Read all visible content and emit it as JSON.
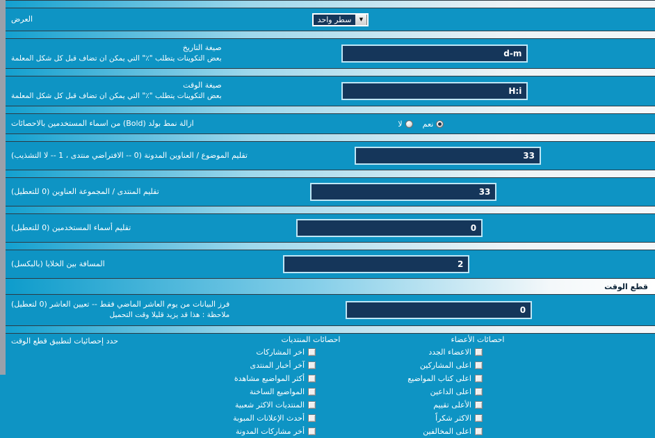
{
  "colors": {
    "page_bg": "#0e94c4",
    "input_bg": "#15365a",
    "input_border": "#bfe6f5",
    "left_border": "#9aa0aa",
    "text": "#ffffff",
    "section_head_text": "#0a2236"
  },
  "rows": {
    "display": {
      "label": "العرض",
      "select_value": "سطر واحد",
      "arrow_icon": "chevron-down-icon"
    },
    "date_format": {
      "label": "صيغة التاريخ",
      "sub": "بعض التكوينات يتطلب \"٪\" التي يمكن ان تضاف قبل كل شكل المعلمة",
      "value": "d-m"
    },
    "time_format": {
      "label": "صيغة الوقت",
      "sub": "بعض التكوينات يتطلب \"٪\" التي يمكن ان تضاف قبل كل شكل المعلمة",
      "value": "H:i"
    },
    "remove_bold": {
      "label": "ازالة نمط بولد (Bold) من اسماء المستخدمين بالاحصائات",
      "options": [
        {
          "label": "نعم",
          "selected": true
        },
        {
          "label": "لا",
          "selected": false
        }
      ]
    },
    "trim_thread_titles": {
      "label": "تقليم الموضوع / العناوين المدونة (0 -- الافتراضي منتدى ، 1 -- لا التشذيب)",
      "value": "33"
    },
    "trim_forum_titles": {
      "label": "تقليم المنتدى / المجموعة العناوين (0 للتعطيل)",
      "value": "33"
    },
    "trim_usernames": {
      "label": "تقليم أسماء المستخدمين (0 للتعطيل)",
      "value": "0"
    },
    "cell_spacing": {
      "label": "المسافة بين الخلايا (بالبكسل)",
      "value": "2"
    }
  },
  "timeout_section": {
    "header": "قطع الوقت",
    "cutoff": {
      "label": "فرز البيانات من يوم العاشر الماضي فقط -- تعيين العاشر (0 لتعطيل)",
      "sub": "ملاحظة : هذا قد يزيد قليلا وقت التحميل",
      "value": "0"
    },
    "select_stats": {
      "label": "حدد إحصائيات لتطبيق قطع الوقت",
      "columns": [
        {
          "title": "احصائات الأعضاء",
          "items": [
            {
              "label": "الاعضاء الجدد",
              "checked": false
            },
            {
              "label": "اعلى المشاركين",
              "checked": false
            },
            {
              "label": "اعلى كتاب المواضيع",
              "checked": false
            },
            {
              "label": "اعلى الداعين",
              "checked": false
            },
            {
              "label": "الأعلى تقييم",
              "checked": false
            },
            {
              "label": "الاكثر شكراً",
              "checked": false
            },
            {
              "label": "اعلى المخالفين",
              "checked": false
            }
          ]
        },
        {
          "title": "احصائات المنتديات",
          "items": [
            {
              "label": "اخر المشاركات",
              "checked": false
            },
            {
              "label": "آخر أخبار المنتدى",
              "checked": false
            },
            {
              "label": "أكثر المواضيع مشاهدة",
              "checked": false
            },
            {
              "label": "المواضيع الساخنة",
              "checked": false
            },
            {
              "label": "المنتديات الاكثر شعبية",
              "checked": false
            },
            {
              "label": "أحدث الإعلانات المبوبة",
              "checked": false
            },
            {
              "label": "أخر مشاركات المدونة",
              "checked": false
            }
          ]
        }
      ]
    }
  }
}
